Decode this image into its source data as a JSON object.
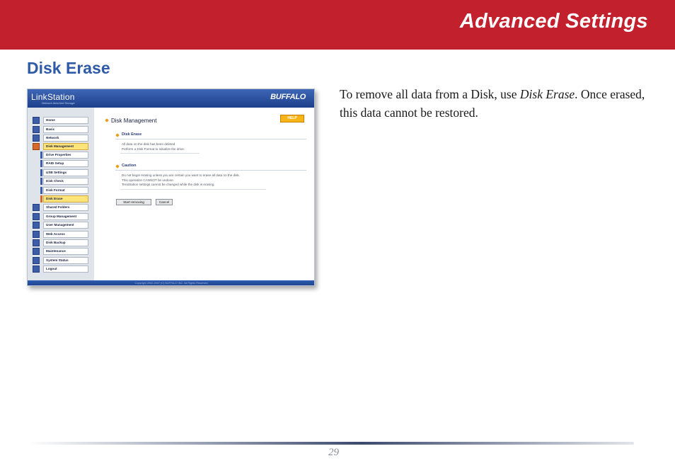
{
  "header": {
    "title": "Advanced Settings"
  },
  "section": {
    "title": "Disk Erase"
  },
  "body": {
    "text_before": "To remove all data from a Disk, use ",
    "text_emphasis": "Disk Erase",
    "text_after": ". Once erased, this data cannot be restored."
  },
  "screenshot": {
    "logo": "LinkStation",
    "logo_sub": "Network Attached Storage",
    "brand": "BUFFALO",
    "nav": [
      {
        "label": "Home"
      },
      {
        "label": "Basic"
      },
      {
        "label": "Network"
      },
      {
        "label": "Disk Management"
      },
      {
        "label": "Drive Properties"
      },
      {
        "label": "RAID Setup"
      },
      {
        "label": "USB Settings"
      },
      {
        "label": "Disk Check"
      },
      {
        "label": "Disk Format"
      },
      {
        "label": "Disk Erase"
      },
      {
        "label": "Shared Folders"
      },
      {
        "label": "Group Management"
      },
      {
        "label": "User Management"
      },
      {
        "label": "Web Access"
      },
      {
        "label": "Disk Backup"
      },
      {
        "label": "Maintenance"
      },
      {
        "label": "System Status"
      },
      {
        "label": "Logout"
      }
    ],
    "main_title": "Disk Management",
    "help": "HELP",
    "disk_erase_heading": "Disk Erase",
    "disk_erase_lines": [
      "All data on the disk has been deleted.",
      "Perform a Disk Format to initialize the drive."
    ],
    "caution_heading": "Caution",
    "caution_lines": [
      "Do not begin erasing unless you are certain you want to erase all data on the disk.",
      "This operation CANNOT be undone.",
      "TeraStation settings cannot be changed while the disk is erasing."
    ],
    "start_button": "Start removing",
    "cancel_button": "Cancel",
    "copyright": "Copyright 2002-2007 (C) BUFFALO INC. All Rights Reserved."
  },
  "footer": {
    "page_number": "29"
  }
}
